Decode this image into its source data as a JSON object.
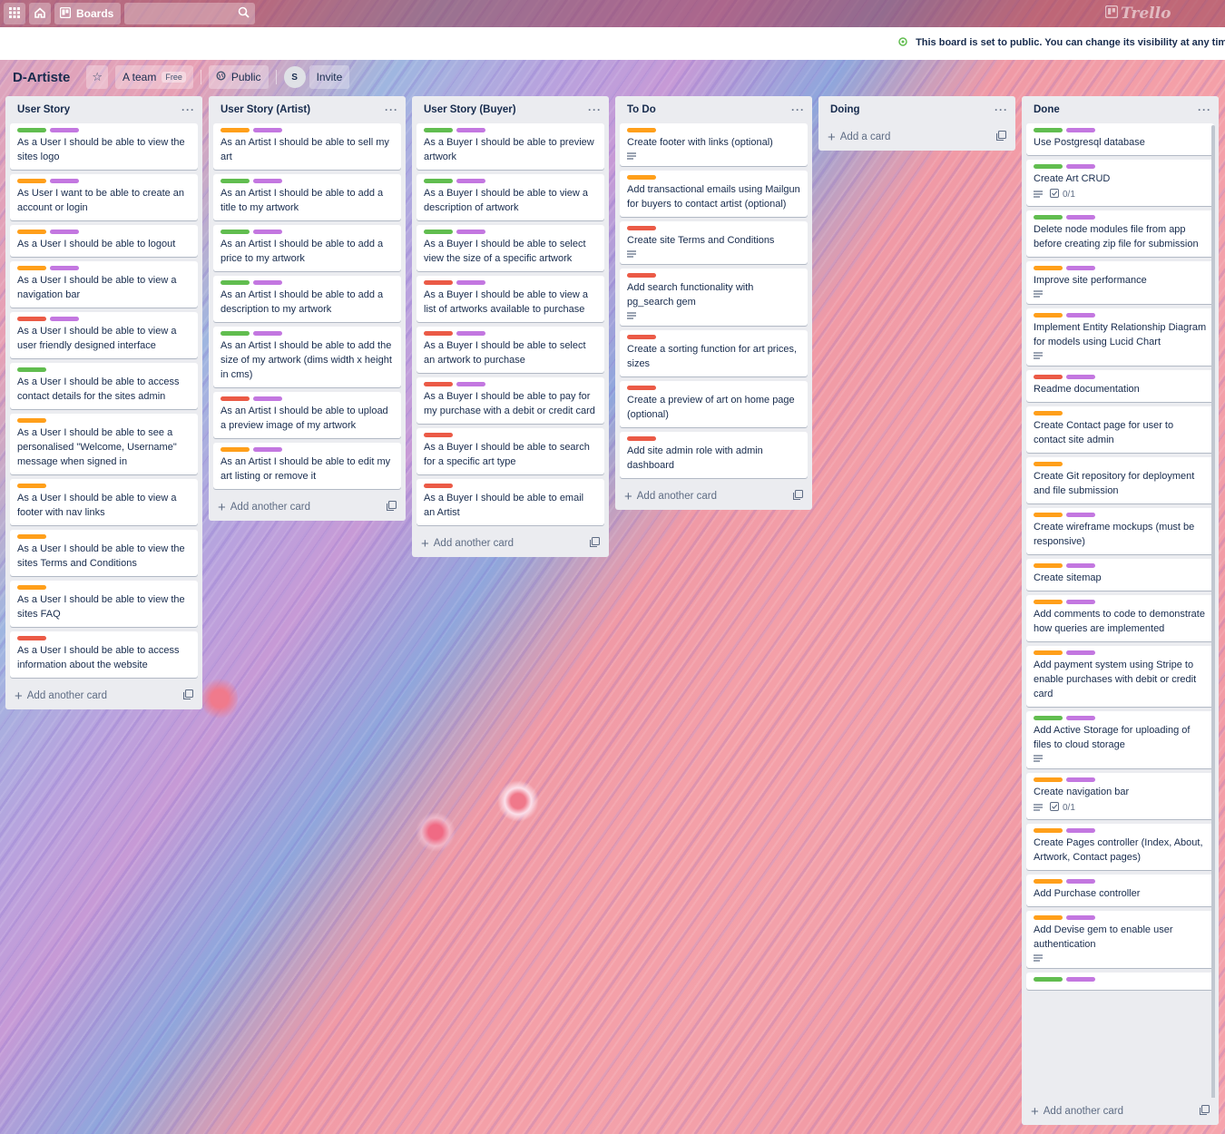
{
  "topbar": {
    "boards_label": "Boards",
    "logo_text": "Trello"
  },
  "banner": {
    "message": "This board is set to public. You can change its visibility at any time."
  },
  "board": {
    "title": "D-Artiste",
    "team_label": "A team",
    "team_badge": "Free",
    "visibility_label": "Public",
    "avatar_initial": "S",
    "invite_label": "Invite"
  },
  "colors": {
    "green": "#61bd4f",
    "purple": "#c377e0",
    "orange": "#ff9f1a",
    "red": "#eb5a46"
  },
  "lists": [
    {
      "name": "User Story",
      "add_label": "Add another card",
      "cards": [
        {
          "labels": [
            "green",
            "purple"
          ],
          "title": "As a User I should be able to view the sites logo"
        },
        {
          "labels": [
            "orange",
            "purple"
          ],
          "title": "As User I want to be able to create an account or login"
        },
        {
          "labels": [
            "orange",
            "purple"
          ],
          "title": "As a User I should be able to logout"
        },
        {
          "labels": [
            "orange",
            "purple"
          ],
          "title": "As a User I should be able to view a navigation bar"
        },
        {
          "labels": [
            "red",
            "purple"
          ],
          "title": "As a User I should be able to view a user friendly designed interface"
        },
        {
          "labels": [
            "green"
          ],
          "title": "As a User I should be able to access contact details for the sites admin"
        },
        {
          "labels": [
            "orange"
          ],
          "title": "As a User I should be able to see a personalised \"Welcome, Username\" message when signed in"
        },
        {
          "labels": [
            "orange"
          ],
          "title": "As a User I should be able to view a footer with nav links"
        },
        {
          "labels": [
            "orange"
          ],
          "title": "As a User I should be able to view the sites Terms and Conditions"
        },
        {
          "labels": [
            "orange"
          ],
          "title": "As a User I should be able to view the sites FAQ"
        },
        {
          "labels": [
            "red"
          ],
          "title": "As a User I should be able to access information about the website"
        }
      ]
    },
    {
      "name": "User Story (Artist)",
      "add_label": "Add another card",
      "cards": [
        {
          "labels": [
            "orange",
            "purple"
          ],
          "title": "As an Artist I should be able to sell my art"
        },
        {
          "labels": [
            "green",
            "purple"
          ],
          "title": "As an Artist I should be able to add a title to my artwork"
        },
        {
          "labels": [
            "green",
            "purple"
          ],
          "title": "As an Artist I should be able to add a price to my artwork"
        },
        {
          "labels": [
            "green",
            "purple"
          ],
          "title": "As an Artist I should be able to add a description to my artwork"
        },
        {
          "labels": [
            "green",
            "purple"
          ],
          "title": "As an Artist I should be able to add the size of my artwork (dims width x height in cms)"
        },
        {
          "labels": [
            "red",
            "purple"
          ],
          "title": "As an Artist I should be able to upload a preview image of my artwork"
        },
        {
          "labels": [
            "orange",
            "purple"
          ],
          "title": "As an Artist I should be able to edit my art listing or remove it"
        }
      ]
    },
    {
      "name": "User Story (Buyer)",
      "add_label": "Add another card",
      "cards": [
        {
          "labels": [
            "green",
            "purple"
          ],
          "title": "As a Buyer I should be able to preview artwork"
        },
        {
          "labels": [
            "green",
            "purple"
          ],
          "title": "As a Buyer I should be able to view a description of artwork"
        },
        {
          "labels": [
            "green",
            "purple"
          ],
          "title": "As a Buyer I should be able to select view the size of a specific artwork"
        },
        {
          "labels": [
            "red",
            "purple"
          ],
          "title": "As a Buyer I should be able to view a list of artworks available to purchase"
        },
        {
          "labels": [
            "red",
            "purple"
          ],
          "title": "As a Buyer I should be able to select an artwork to purchase"
        },
        {
          "labels": [
            "red",
            "purple"
          ],
          "title": "As a Buyer I should be able to pay for my purchase with a debit or credit card"
        },
        {
          "labels": [
            "red"
          ],
          "title": "As a Buyer I should be able to search for a specific art type"
        },
        {
          "labels": [
            "red"
          ],
          "title": "As a Buyer I should be able to email an Artist"
        }
      ]
    },
    {
      "name": "To Do",
      "add_label": "Add another card",
      "cards": [
        {
          "labels": [
            "orange"
          ],
          "title": "Create footer with links (optional)",
          "desc": true
        },
        {
          "labels": [
            "orange"
          ],
          "title": "Add transactional emails using Mailgun for buyers to contact artist (optional)"
        },
        {
          "labels": [
            "red"
          ],
          "title": "Create site Terms and Conditions",
          "desc": true
        },
        {
          "labels": [
            "red"
          ],
          "title": "Add search functionality with pg_search gem",
          "desc": true
        },
        {
          "labels": [
            "red"
          ],
          "title": "Create a sorting function for art prices, sizes"
        },
        {
          "labels": [
            "red"
          ],
          "title": "Create a preview of art on home page (optional)"
        },
        {
          "labels": [
            "red"
          ],
          "title": "Add site admin role with admin dashboard"
        }
      ]
    },
    {
      "name": "Doing",
      "add_label": "Add a card",
      "cards": []
    },
    {
      "name": "Done",
      "add_label": "Add another card",
      "cards": [
        {
          "labels": [
            "green",
            "purple"
          ],
          "title": "Use Postgresql database"
        },
        {
          "labels": [
            "green",
            "purple"
          ],
          "title": "Create Art CRUD",
          "desc": true,
          "checklist": "0/1"
        },
        {
          "labels": [
            "green",
            "purple"
          ],
          "title": "Delete node modules file from app before creating zip file for submission"
        },
        {
          "labels": [
            "orange",
            "purple"
          ],
          "title": "Improve site performance",
          "desc": true
        },
        {
          "labels": [
            "orange",
            "purple"
          ],
          "title": "Implement Entity Relationship Diagram for models using Lucid Chart",
          "desc": true
        },
        {
          "labels": [
            "red",
            "purple"
          ],
          "title": "Readme documentation"
        },
        {
          "labels": [
            "orange"
          ],
          "title": "Create Contact page for user to contact site admin"
        },
        {
          "labels": [
            "orange"
          ],
          "title": "Create Git repository for deployment and file submission"
        },
        {
          "labels": [
            "orange",
            "purple"
          ],
          "title": "Create wireframe mockups (must be responsive)"
        },
        {
          "labels": [
            "orange",
            "purple"
          ],
          "title": "Create sitemap"
        },
        {
          "labels": [
            "orange",
            "purple"
          ],
          "title": "Add comments to code to demonstrate how queries are implemented"
        },
        {
          "labels": [
            "orange",
            "purple"
          ],
          "title": "Add payment system using Stripe to enable purchases with debit or credit card"
        },
        {
          "labels": [
            "green",
            "purple"
          ],
          "title": "Add Active Storage for uploading of files to cloud storage",
          "desc": true
        },
        {
          "labels": [
            "orange",
            "purple"
          ],
          "title": "Create navigation bar",
          "desc": true,
          "checklist": "0/1"
        },
        {
          "labels": [
            "orange",
            "purple"
          ],
          "title": "Create Pages controller (Index, About, Artwork, Contact pages)"
        },
        {
          "labels": [
            "orange",
            "purple"
          ],
          "title": "Add Purchase controller"
        },
        {
          "labels": [
            "orange",
            "purple"
          ],
          "title": "Add Devise gem to enable user authentication",
          "desc": true
        },
        {
          "labels": [
            "green",
            "purple"
          ],
          "title": ""
        }
      ]
    }
  ]
}
